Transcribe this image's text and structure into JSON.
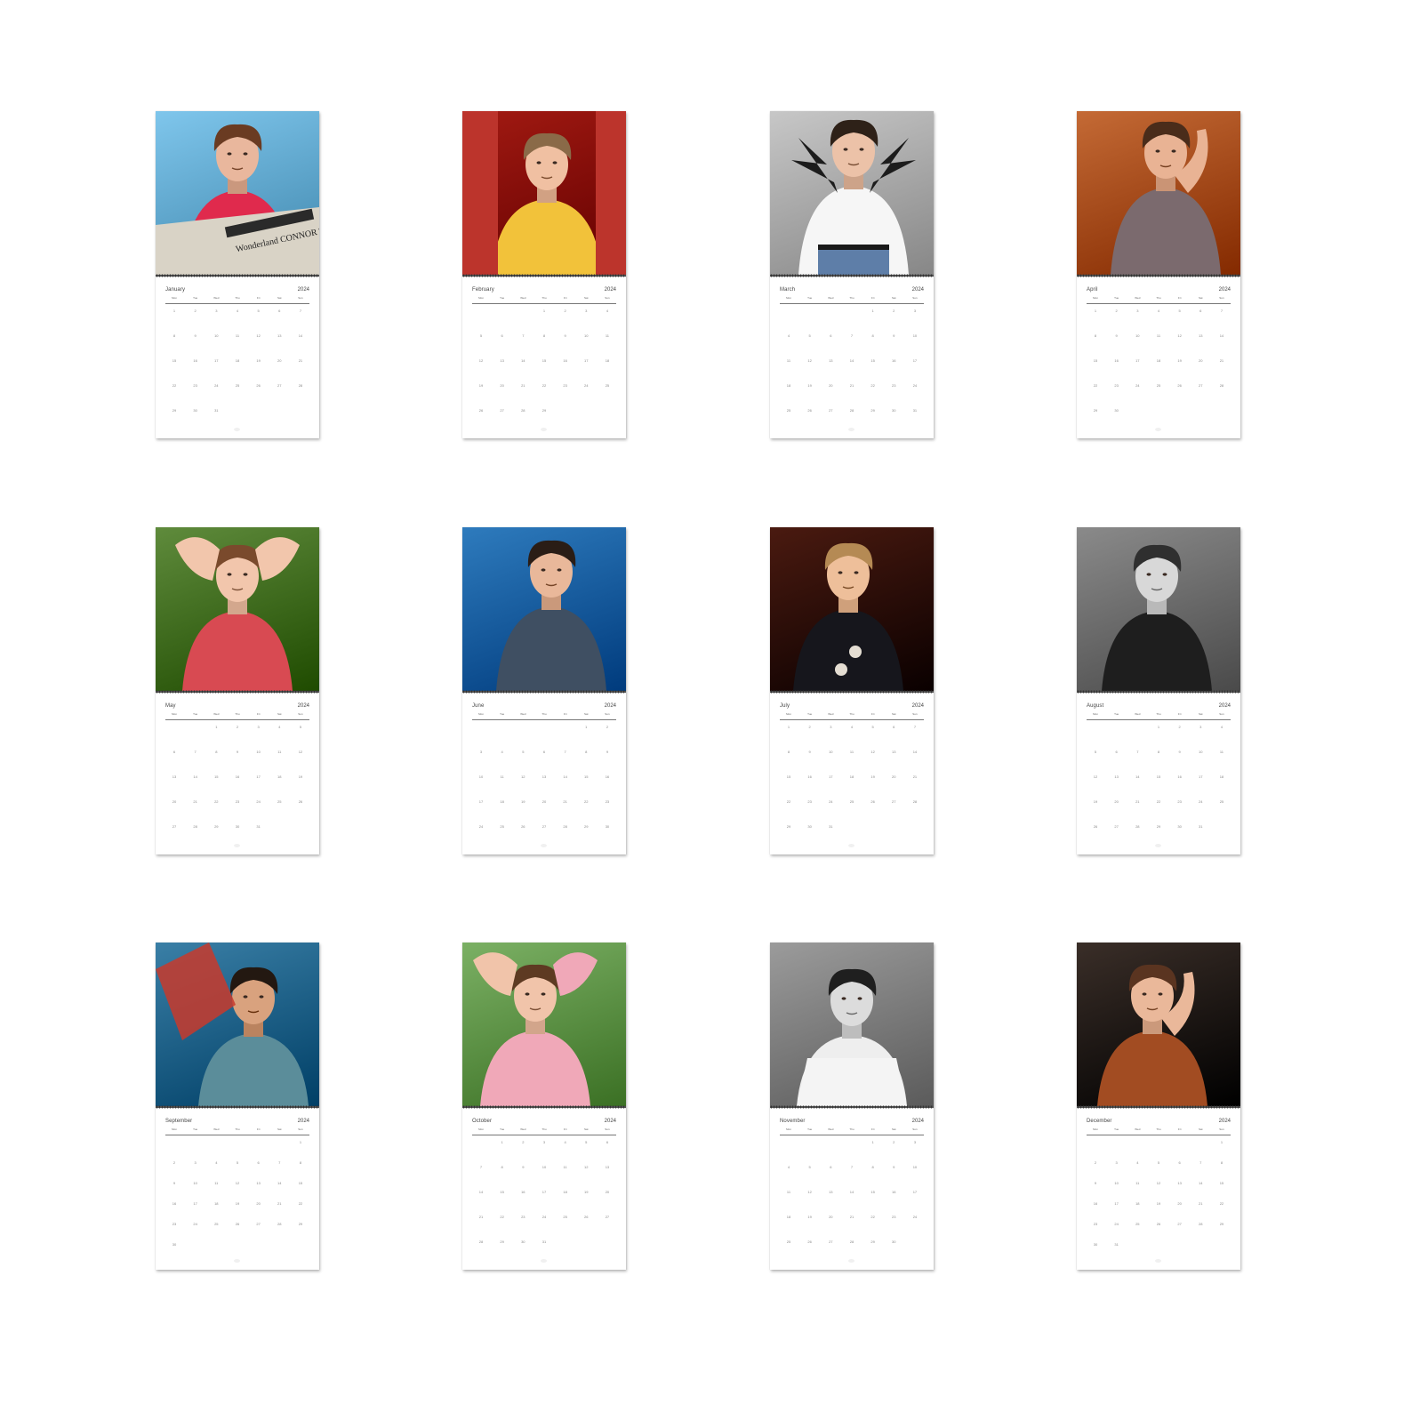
{
  "year": "2024",
  "weekdays": [
    "Mon",
    "Tue",
    "Wed",
    "Thu",
    "Fri",
    "Sat",
    "Sun"
  ],
  "months": [
    {
      "name": "January",
      "photo_bg": "#7fc6ec",
      "skin": "#e9b79d",
      "hair": "#6a3b22",
      "shirt": "#e02a4d",
      "prop": "#d9d3c6",
      "prop_text": "Wonderland  CONNOR TELLS",
      "weeks": [
        [
          "1",
          "2",
          "3",
          "4",
          "5",
          "6",
          "7"
        ],
        [
          "8",
          "9",
          "10",
          "11",
          "12",
          "13",
          "14"
        ],
        [
          "15",
          "16",
          "17",
          "18",
          "19",
          "20",
          "21"
        ],
        [
          "22",
          "23",
          "24",
          "25",
          "26",
          "27",
          "28"
        ],
        [
          "29",
          "30",
          "31",
          "",
          "",
          "",
          ""
        ]
      ]
    },
    {
      "name": "February",
      "photo_bg": "#a21a12",
      "skin": "#f0c0a2",
      "hair": "#8a6a48",
      "shirt": "#f2c23a",
      "prop": "#2d6fd1",
      "prop_text": "",
      "weeks": [
        [
          "",
          "",
          "",
          "1",
          "2",
          "3",
          "4"
        ],
        [
          "5",
          "6",
          "7",
          "8",
          "9",
          "10",
          "11"
        ],
        [
          "12",
          "13",
          "14",
          "15",
          "16",
          "17",
          "18"
        ],
        [
          "19",
          "20",
          "21",
          "22",
          "23",
          "24",
          "25"
        ],
        [
          "26",
          "27",
          "28",
          "29",
          "",
          "",
          ""
        ]
      ]
    },
    {
      "name": "March",
      "photo_bg": "#c7c7c7",
      "skin": "#ecc2a8",
      "hair": "#2e2118",
      "shirt": "#f6f6f6",
      "prop": "#1c1c1c",
      "prop_text": "",
      "weeks": [
        [
          "",
          "",
          "",
          "",
          "1",
          "2",
          "3"
        ],
        [
          "4",
          "5",
          "6",
          "7",
          "8",
          "9",
          "10"
        ],
        [
          "11",
          "12",
          "13",
          "14",
          "15",
          "16",
          "17"
        ],
        [
          "18",
          "19",
          "20",
          "21",
          "22",
          "23",
          "24"
        ],
        [
          "25",
          "26",
          "27",
          "28",
          "29",
          "30",
          "31"
        ]
      ]
    },
    {
      "name": "April",
      "photo_bg": "#c46a35",
      "skin": "#e9b394",
      "hair": "#4a2c1a",
      "shirt": "#7b6a6e",
      "prop": "#b8873f",
      "prop_text": "",
      "weeks": [
        [
          "1",
          "2",
          "3",
          "4",
          "5",
          "6",
          "7"
        ],
        [
          "8",
          "9",
          "10",
          "11",
          "12",
          "13",
          "14"
        ],
        [
          "15",
          "16",
          "17",
          "18",
          "19",
          "20",
          "21"
        ],
        [
          "22",
          "23",
          "24",
          "25",
          "26",
          "27",
          "28"
        ],
        [
          "29",
          "30",
          "",
          "",
          "",
          "",
          ""
        ]
      ]
    },
    {
      "name": "May",
      "photo_bg": "#5f8b3c",
      "skin": "#f2c6ac",
      "hair": "#7a4a2c",
      "shirt": "#d84a52",
      "prop": "#6fa447",
      "prop_text": "",
      "weeks": [
        [
          "",
          "",
          "1",
          "2",
          "3",
          "4",
          "5"
        ],
        [
          "6",
          "7",
          "8",
          "9",
          "10",
          "11",
          "12"
        ],
        [
          "13",
          "14",
          "15",
          "16",
          "17",
          "18",
          "19"
        ],
        [
          "20",
          "21",
          "22",
          "23",
          "24",
          "25",
          "26"
        ],
        [
          "27",
          "28",
          "29",
          "30",
          "31",
          "",
          ""
        ]
      ]
    },
    {
      "name": "June",
      "photo_bg": "#2e7bbd",
      "skin": "#e9b89a",
      "hair": "#2a1d16",
      "shirt": "#3f4f62",
      "prop": "#1d2430",
      "prop_text": "",
      "weeks": [
        [
          "",
          "",
          "",
          "",
          "",
          "1",
          "2"
        ],
        [
          "3",
          "4",
          "5",
          "6",
          "7",
          "8",
          "9"
        ],
        [
          "10",
          "11",
          "12",
          "13",
          "14",
          "15",
          "16"
        ],
        [
          "17",
          "18",
          "19",
          "20",
          "21",
          "22",
          "23"
        ],
        [
          "24",
          "25",
          "26",
          "27",
          "28",
          "29",
          "30"
        ]
      ]
    },
    {
      "name": "July",
      "photo_bg": "#4a1a10",
      "skin": "#eebf9a",
      "hair": "#b58a54",
      "shirt": "#16161c",
      "prop": "#e4ddd2",
      "prop_text": "",
      "weeks": [
        [
          "1",
          "2",
          "3",
          "4",
          "5",
          "6",
          "7"
        ],
        [
          "8",
          "9",
          "10",
          "11",
          "12",
          "13",
          "14"
        ],
        [
          "15",
          "16",
          "17",
          "18",
          "19",
          "20",
          "21"
        ],
        [
          "22",
          "23",
          "24",
          "25",
          "26",
          "27",
          "28"
        ],
        [
          "29",
          "30",
          "31",
          "",
          "",
          "",
          ""
        ]
      ]
    },
    {
      "name": "August",
      "photo_bg": "#8a8a8a",
      "skin": "#d8d8d8",
      "hair": "#2f2f2f",
      "shirt": "#1e1e1e",
      "prop": "#5a5a5a",
      "prop_text": "",
      "weeks": [
        [
          "",
          "",
          "",
          "1",
          "2",
          "3",
          "4"
        ],
        [
          "5",
          "6",
          "7",
          "8",
          "9",
          "10",
          "11"
        ],
        [
          "12",
          "13",
          "14",
          "15",
          "16",
          "17",
          "18"
        ],
        [
          "19",
          "20",
          "21",
          "22",
          "23",
          "24",
          "25"
        ],
        [
          "26",
          "27",
          "28",
          "29",
          "30",
          "31",
          ""
        ]
      ]
    },
    {
      "name": "September",
      "photo_bg": "#3a7fa6",
      "skin": "#d9a27e",
      "hair": "#231811",
      "shirt": "#5b8d9a",
      "prop": "#c83a2c",
      "prop_text": "",
      "weeks": [
        [
          "",
          "",
          "",
          "",
          "",
          "",
          "1"
        ],
        [
          "2",
          "3",
          "4",
          "5",
          "6",
          "7",
          "8"
        ],
        [
          "9",
          "10",
          "11",
          "12",
          "13",
          "14",
          "15"
        ],
        [
          "16",
          "17",
          "18",
          "19",
          "20",
          "21",
          "22"
        ],
        [
          "23",
          "24",
          "25",
          "26",
          "27",
          "28",
          "29"
        ],
        [
          "30",
          "",
          "",
          "",
          "",
          "",
          ""
        ]
      ]
    },
    {
      "name": "October",
      "photo_bg": "#7bb064",
      "skin": "#f1c4aa",
      "hair": "#5e3a22",
      "shirt": "#f0a8b8",
      "prop": "#1f1f1f",
      "prop_text": "",
      "weeks": [
        [
          "",
          "1",
          "2",
          "3",
          "4",
          "5",
          "6"
        ],
        [
          "7",
          "8",
          "9",
          "10",
          "11",
          "12",
          "13"
        ],
        [
          "14",
          "15",
          "16",
          "17",
          "18",
          "19",
          "20"
        ],
        [
          "21",
          "22",
          "23",
          "24",
          "25",
          "26",
          "27"
        ],
        [
          "28",
          "29",
          "30",
          "31",
          "",
          "",
          ""
        ]
      ]
    },
    {
      "name": "November",
      "photo_bg": "#9b9b9b",
      "skin": "#dcdcdc",
      "hair": "#1f1f1f",
      "shirt": "#eeeeee",
      "prop": "#2a2a2a",
      "prop_text": "",
      "weeks": [
        [
          "",
          "",
          "",
          "",
          "1",
          "2",
          "3"
        ],
        [
          "4",
          "5",
          "6",
          "7",
          "8",
          "9",
          "10"
        ],
        [
          "11",
          "12",
          "13",
          "14",
          "15",
          "16",
          "17"
        ],
        [
          "18",
          "19",
          "20",
          "21",
          "22",
          "23",
          "24"
        ],
        [
          "25",
          "26",
          "27",
          "28",
          "29",
          "30",
          ""
        ]
      ]
    },
    {
      "name": "December",
      "photo_bg": "#3a2e28",
      "skin": "#eab89a",
      "hair": "#5a3420",
      "shirt": "#a24c22",
      "prop": "#1c1715",
      "prop_text": "",
      "weeks": [
        [
          "",
          "",
          "",
          "",
          "",
          "",
          "1"
        ],
        [
          "2",
          "3",
          "4",
          "5",
          "6",
          "7",
          "8"
        ],
        [
          "9",
          "10",
          "11",
          "12",
          "13",
          "14",
          "15"
        ],
        [
          "16",
          "17",
          "18",
          "19",
          "20",
          "21",
          "22"
        ],
        [
          "23",
          "24",
          "25",
          "26",
          "27",
          "28",
          "29"
        ],
        [
          "30",
          "31",
          "",
          "",
          "",
          "",
          ""
        ]
      ]
    }
  ]
}
